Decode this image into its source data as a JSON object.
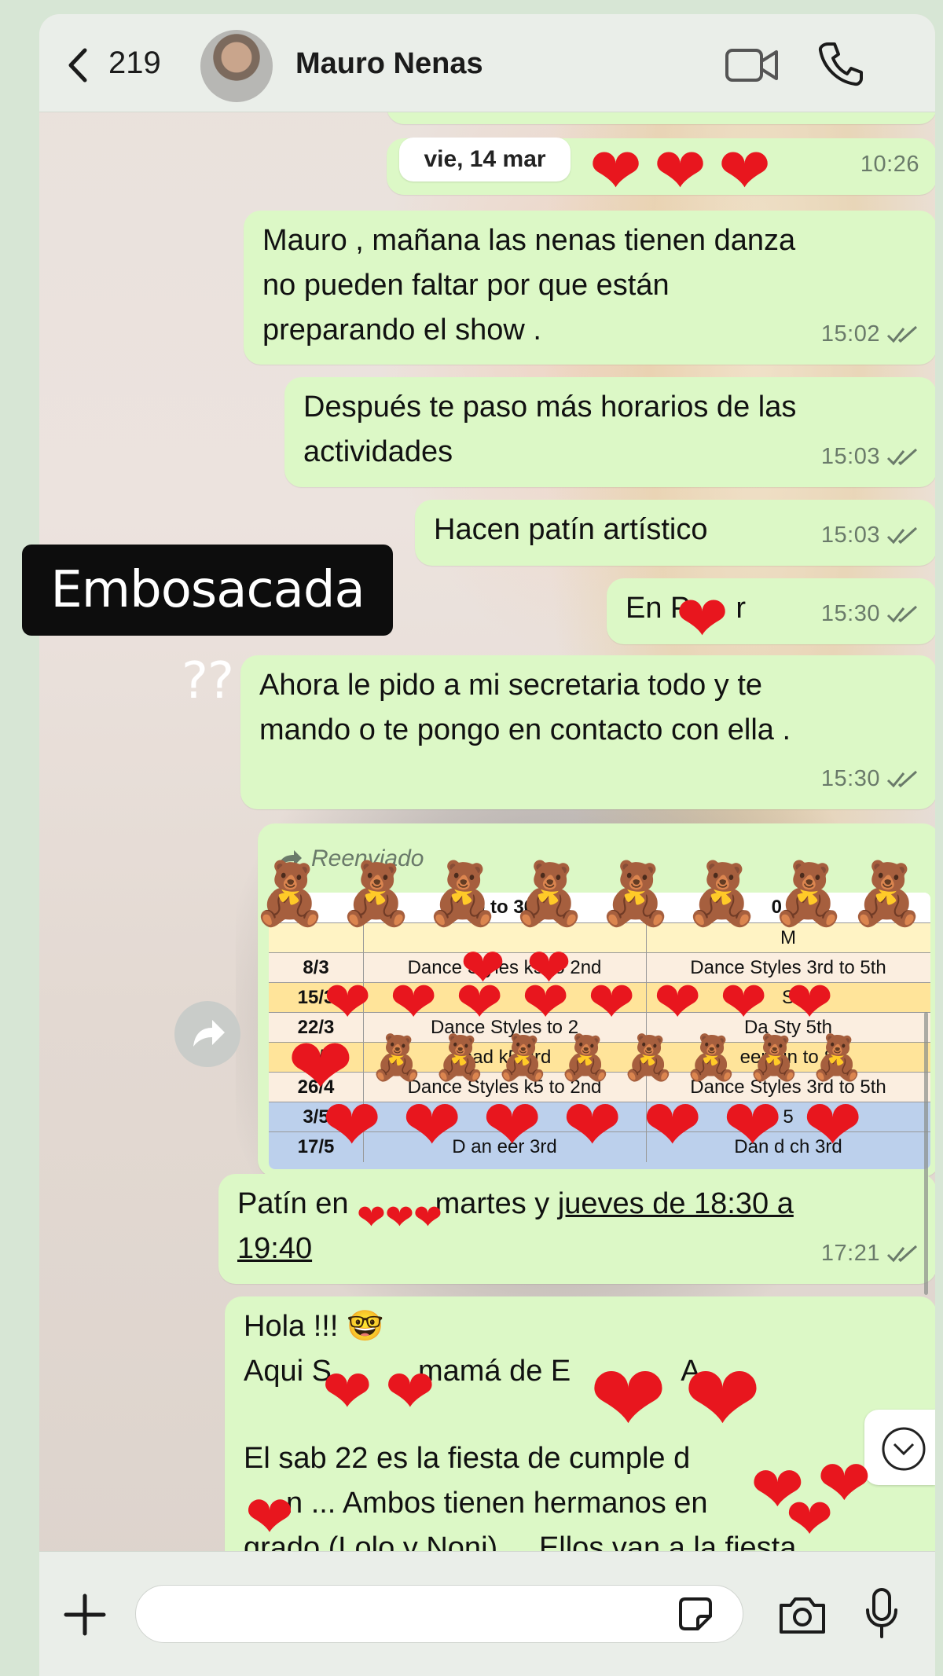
{
  "header": {
    "back_count": "219",
    "contact_name": "Mauro Nenas"
  },
  "date_chip": "vie, 14 mar",
  "overlay_label": "Embosacada ??",
  "messages": [
    {
      "text": "",
      "time": "10:26"
    },
    {
      "text": "Mauro , mañana las nenas tienen danza\nno pueden faltar por que están\npreparando el show .",
      "time": "15:02"
    },
    {
      "text": "Después te paso más horarios de las\nactividades",
      "time": "15:03"
    },
    {
      "text": "Hacen patín artístico",
      "time": "15:03"
    },
    {
      "text": "En P",
      "text_tail": "r",
      "time": "15:30"
    },
    {
      "text": "Ahora le pido a mi secretaria todo y te\nmando o te pongo en contacto con ella .",
      "time": "15:30"
    },
    {
      "text": "Patín en",
      "text_mid": "martes y ",
      "text_link": "jueves de 18:30 a\n19:40",
      "time": "17:21"
    },
    {
      "text": "Hola !!! 🤓\nAqui S",
      "text_mid": "mamá de E",
      "text_tail": "A .",
      "text_p2": "El sab 22 es la fiesta de cumple d",
      "text_p3": "n ... Ambos tienen hermanos en",
      "text_p4": "grado (Lolo y Noni) ... Ellos van a la fiesta"
    }
  ],
  "forwarded": {
    "label": "Reenviado",
    "header_row": [
      "",
      "9 to 30",
      "0 to"
    ],
    "rows": [
      {
        "date": "",
        "c1": "",
        "c2": "M"
      },
      {
        "date": "8/3",
        "c1": "Dance Styles k5 to 2nd",
        "c2": "Dance Styles 3rd to 5th"
      },
      {
        "date": "15/3",
        "c1": "",
        "c2": "S"
      },
      {
        "date": "22/3",
        "c1": "Dance Styles to 2",
        "c2": "Da Sty 5th"
      },
      {
        "date": "29/3",
        "c1": "lead k5 3rd",
        "c2": "eer din to S"
      },
      {
        "date": "26/4",
        "c1": "Dance Styles k5 to 2nd",
        "c2": "Dance Styles 3rd to 5th"
      },
      {
        "date": "3/5",
        "c1": "a",
        "c2": "5"
      },
      {
        "date": "17/5",
        "c1": "D an eer 3rd",
        "c2": "Dan d ch 3rd"
      }
    ]
  },
  "colors": {
    "bubble": "#dcf8c6",
    "heart": "#e8161e",
    "overlay_bg": "#0d0d0d"
  },
  "icons": [
    "back-chevron-icon",
    "video-call-icon",
    "phone-call-icon",
    "forward-arrow-icon",
    "share-icon",
    "plus-icon",
    "sticker-icon",
    "camera-icon",
    "microphone-icon",
    "chevron-down-icon",
    "double-check-icon"
  ]
}
